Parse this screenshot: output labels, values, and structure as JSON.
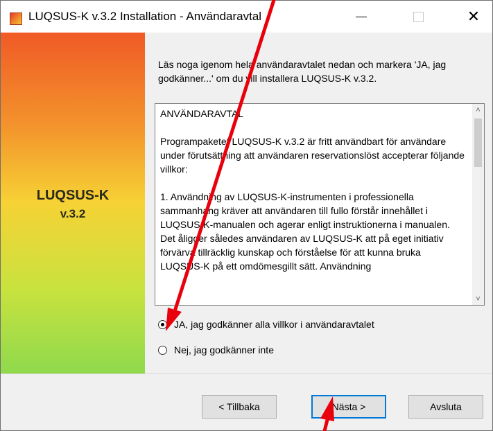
{
  "window": {
    "title": "LUQSUS-K v.3.2 Installation - Användaravtal",
    "app_icon": "installer-icon",
    "controls": {
      "minimize": "minimize-icon",
      "maximize": "maximize-icon",
      "close_label": "✕"
    }
  },
  "sidebar": {
    "brand_line1": "LUQSUS-K",
    "brand_line2": "v.3.2",
    "gradient_colors": [
      "#f05a26",
      "#f3952c",
      "#f6d235",
      "#c9e23e",
      "#8fd94d"
    ]
  },
  "content": {
    "intro": "Läs noga igenom hela användaravtalet nedan och markera 'JA, jag godkänner...' om du vill installera LUQSUS-K v.3.2.",
    "license_paragraphs": [
      "ANVÄNDARAVTAL",
      "Programpaketet LUQSUS-K v.3.2 är fritt användbart för användare under förutsättning att användaren reservationslöst accepterar följande villkor:",
      "1. Användning av LUQSUS-K-instrumenten i professionella sammanhang kräver att användaren till fullo förstår innehållet i LUQSUS-K-manualen och agerar enligt instruktionerna i manualen. Det åligger således användaren av LUQSUS-K att på eget initiativ förvärva tillräcklig kunskap och förståelse för att kunna bruka LUQSUS-K på ett omdömesgillt sätt. Användning"
    ],
    "scroll_up": "˄",
    "scroll_down": "˅",
    "radio_accept": {
      "label": "JA, jag godkänner alla villkor i användaravtalet",
      "checked": true
    },
    "radio_decline": {
      "label": "Nej, jag godkänner inte",
      "checked": false
    }
  },
  "footer": {
    "back_label": "< Tillbaka",
    "next_label": "Nästa >",
    "cancel_label": "Avsluta"
  },
  "annotations": {
    "arrow_color": "#e8000c"
  }
}
